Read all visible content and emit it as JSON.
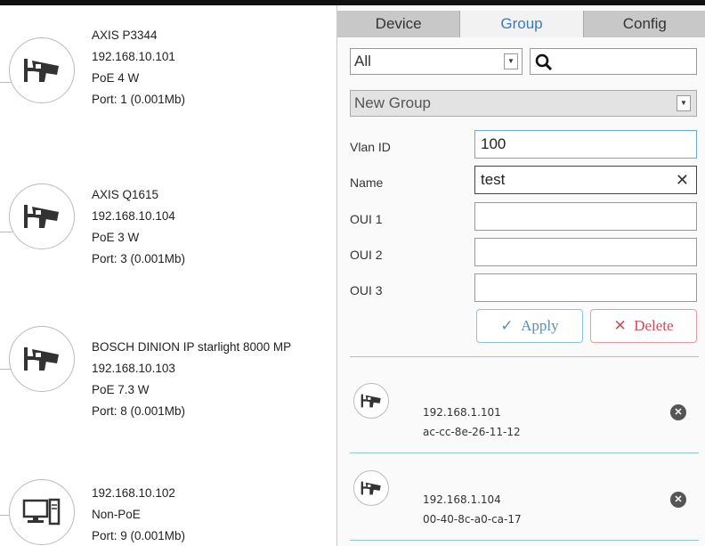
{
  "devices": [
    {
      "name": "AXIS P3344",
      "ip": "192.168.10.101",
      "poe": "PoE 4 W",
      "port": "Port: 1 (0.001Mb)",
      "icon": "camera-icon"
    },
    {
      "name": "AXIS Q1615",
      "ip": "192.168.10.104",
      "poe": "PoE 3 W",
      "port": "Port: 3 (0.001Mb)",
      "icon": "camera-icon"
    },
    {
      "name": "BOSCH DINION IP starlight 8000 MP",
      "ip": "192.168.10.103",
      "poe": "PoE 7.3 W",
      "port": "Port: 8 (0.001Mb)",
      "icon": "camera-icon"
    },
    {
      "ip": "192.168.10.102",
      "poe": "Non-PoE",
      "port": "Port: 9 (0.001Mb)",
      "icon": "computer-icon"
    }
  ],
  "tabs": [
    {
      "label": "Device",
      "active": false
    },
    {
      "label": "Group",
      "active": true
    },
    {
      "label": "Config",
      "active": false
    }
  ],
  "filter": {
    "value": "All",
    "search_value": ""
  },
  "group_select": {
    "value": "New Group"
  },
  "form": {
    "vlan_label": "Vlan ID",
    "vlan_value": "100",
    "name_label": "Name",
    "name_value": "test",
    "oui1_label": "OUI 1",
    "oui1_value": "",
    "oui2_label": "OUI 2",
    "oui2_value": "",
    "oui3_label": "OUI 3",
    "oui3_value": ""
  },
  "buttons": {
    "apply": "Apply",
    "apply_icon": "✓",
    "delete": "Delete",
    "delete_icon": "✕"
  },
  "members": [
    {
      "ip": "192.168.1.101",
      "mac": "ac-cc-8e-26-11-12",
      "icon": "camera-icon"
    },
    {
      "ip": "192.168.1.104",
      "mac": "00-40-8c-a0-ca-17",
      "icon": "camera-icon"
    }
  ],
  "colors": {
    "active_tab": "#3a7bbf",
    "apply": "#5a8db5",
    "delete": "#c8505a"
  }
}
